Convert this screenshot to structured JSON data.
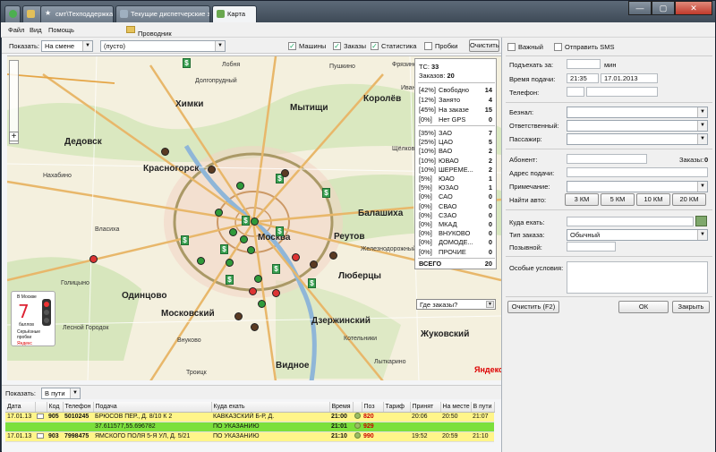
{
  "tabs": [
    {
      "label": "",
      "icon": "green-circle-icon",
      "color": "#4caf50"
    },
    {
      "label": "",
      "icon": "folder-icon",
      "color": "#e3c05a"
    },
    {
      "label": "смт\\Техподдержка",
      "icon": "star-icon",
      "color": "#ffffff"
    },
    {
      "label": "Текущие диспетчерские зая",
      "icon": "tab-icon",
      "color": "#9fb0c0"
    },
    {
      "label": "Карта",
      "icon": "map-icon",
      "color": "#6aa84f"
    }
  ],
  "window_controls": {
    "minimize": "—",
    "maximize": "▢",
    "close": "✕"
  },
  "menu": {
    "file": "Файл",
    "view": "Вид",
    "help": "Помощь",
    "explorer": "Проводник"
  },
  "toolbar": {
    "show_label": "Показать:",
    "show_value": "На смене",
    "filter_value": "(пусто)",
    "cars": "Машины",
    "orders": "Заказы",
    "stats": "Статистика",
    "jams": "Пробки",
    "clear": "Очистить"
  },
  "map": {
    "labels": [
      "Москва",
      "Химки",
      "Долгопрудный",
      "Мытищи",
      "Королёв",
      "Балашиха",
      "Реутов",
      "Люберцы",
      "Дзержинский",
      "Одинцово",
      "Красногорск",
      "Видное",
      "Железнодорожный",
      "Фрязино",
      "Щёлково",
      "Пушкино",
      "Лобня",
      "Дедовск",
      "Внуково",
      "Московский",
      "Жуковский",
      "Котельники",
      "Лыткарино",
      "Ивантеевка",
      "Нахабино",
      "Троицк",
      "Голицыно",
      "Лесной Городок",
      "Власиха"
    ],
    "traffic": {
      "city": "В Москве",
      "score": "7",
      "unit": "баллов",
      "desc": "Серьёзные пробки",
      "brand": "Яндекс"
    },
    "brand": "Яндекс"
  },
  "stats": {
    "tc_label": "ТС:",
    "tc_value": "33",
    "orders_label": "Заказов:",
    "orders_value": "20",
    "status": [
      {
        "pct": "[42%]",
        "name": "Свободно",
        "value": "14"
      },
      {
        "pct": "[12%]",
        "name": "Занято",
        "value": "4"
      },
      {
        "pct": "[45%]",
        "name": "На заказе",
        "value": "15"
      },
      {
        "pct": "[0%]",
        "name": "Нет GPS",
        "value": "0"
      }
    ],
    "districts": [
      {
        "pct": "[35%]",
        "name": "ЗАО",
        "value": "7"
      },
      {
        "pct": "[25%]",
        "name": "ЦАО",
        "value": "5"
      },
      {
        "pct": "[10%]",
        "name": "ВАО",
        "value": "2"
      },
      {
        "pct": "[10%]",
        "name": "ЮВАО",
        "value": "2"
      },
      {
        "pct": "[10%]",
        "name": "ШЕРЕМЕ...",
        "value": "2"
      },
      {
        "pct": "[5%]",
        "name": "ЮАО",
        "value": "1"
      },
      {
        "pct": "[5%]",
        "name": "ЮЗАО",
        "value": "1"
      },
      {
        "pct": "[0%]",
        "name": "САО",
        "value": "0"
      },
      {
        "pct": "[0%]",
        "name": "СВАО",
        "value": "0"
      },
      {
        "pct": "[0%]",
        "name": "СЗАО",
        "value": "0"
      },
      {
        "pct": "[0%]",
        "name": "МКАД",
        "value": "0"
      },
      {
        "pct": "[0%]",
        "name": "ВНУКОВО",
        "value": "0"
      },
      {
        "pct": "[0%]",
        "name": "ДОМОДЕ...",
        "value": "0"
      },
      {
        "pct": "[0%]",
        "name": "ПРОЧИЕ",
        "value": "0"
      }
    ],
    "total_label": "ВСЕГО",
    "total_value": "20",
    "where_orders": "Где заказы?"
  },
  "status_bar": {
    "show_label": "Показать:",
    "show_value": "В пути"
  },
  "orders_table": {
    "headers": [
      "Дата",
      "",
      "Код",
      "Телефон",
      "Подача",
      "Куда ехать",
      "Время",
      "",
      "Поз",
      "Тариф",
      "Принят",
      "На месте",
      "В пути"
    ],
    "rows": [
      {
        "date": "17.01.13",
        "code": "905",
        "phone": "5010245",
        "from": "БРЮСОВ ПЕР., Д. 8/10 К 2",
        "to": "КАВКАЗСКИЙ Б-Р, Д.",
        "time": "21:00",
        "pos": "820",
        "tariff": "",
        "accepted": "20:06",
        "onsite": "20:50",
        "enroute": "21:07",
        "style": "yellow"
      },
      {
        "date": "",
        "code": "",
        "phone": "",
        "from": "37.611577,55.696782",
        "to": "ПО УКАЗАНИЮ",
        "time": "21:01",
        "pos": "929",
        "tariff": "",
        "accepted": "",
        "onsite": "",
        "enroute": "",
        "style": "green"
      },
      {
        "date": "17.01.13",
        "code": "903",
        "phone": "7998475",
        "from": "ЯМСКОГО ПОЛЯ 5-Я УЛ, Д. 5/21",
        "to": "ПО УКАЗАНИЮ",
        "time": "21:10",
        "pos": "990",
        "tariff": "",
        "accepted": "19:52",
        "onsite": "20:59",
        "enroute": "21:10",
        "style": "yellow"
      }
    ]
  },
  "form": {
    "important": "Важный",
    "send_sms": "Отправить SMS",
    "arrive_in": "Подъехать за:",
    "minutes": "мин",
    "pickup_time": "Время подачи:",
    "time_value": "21:35",
    "date_value": "17.01.2013",
    "phone": "Телефон:",
    "cashless": "Безнал:",
    "responsible": "Ответственный:",
    "passenger": "Пассажир:",
    "subscriber": "Абонент:",
    "orders_count": "Заказы:",
    "orders_count_value": "0",
    "pickup_address": "Адрес подачи:",
    "note": "Примечание:",
    "find_car": "Найти авто:",
    "km": [
      "3 КМ",
      "5 КМ",
      "10 КМ",
      "20 КМ"
    ],
    "destination": "Куда ехать:",
    "order_type": "Тип заказа:",
    "order_type_value": "Обычный",
    "callsign": "Позывной:",
    "special": "Особые условия:",
    "clear": "Очистить (F2)",
    "ok": "ОК",
    "close": "Закрыть"
  }
}
